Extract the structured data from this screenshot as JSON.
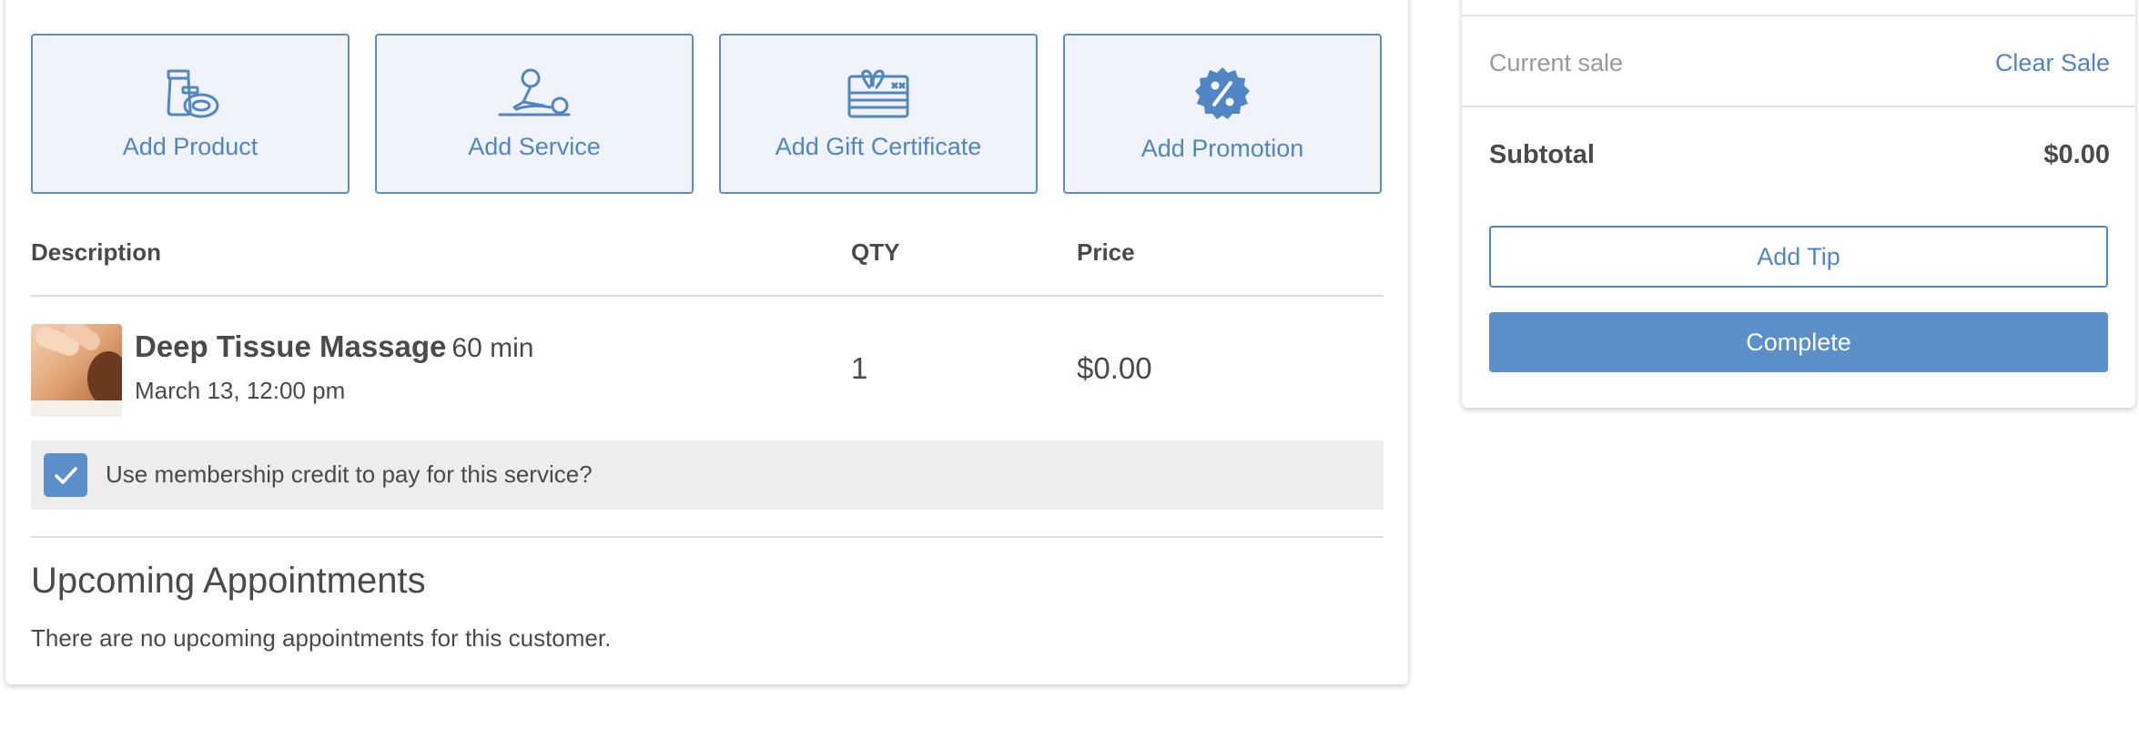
{
  "colors": {
    "accent": "#4f86c3",
    "tile_bg": "#f0f4fa",
    "primary_button": "#5b8fc9",
    "membership_bg": "#ededed",
    "text": "#4a4a4a",
    "muted_text": "#9a9a9a"
  },
  "tiles": [
    {
      "label": "Add Product",
      "icon": "product-icon"
    },
    {
      "label": "Add Service",
      "icon": "service-massage-icon"
    },
    {
      "label": "Add Gift Certificate",
      "icon": "gift-card-icon"
    },
    {
      "label": "Add Promotion",
      "icon": "promotion-percent-badge-icon"
    }
  ],
  "table": {
    "columns": {
      "description": "Description",
      "qty": "QTY",
      "price": "Price"
    },
    "items": [
      {
        "name": "Deep Tissue Massage",
        "duration": "60 min",
        "date": "March 13, 12:00 pm",
        "qty": "1",
        "price": "$0.00"
      }
    ]
  },
  "membership": {
    "checked": true,
    "label": "Use membership credit to pay for this service?"
  },
  "upcoming": {
    "title": "Upcoming Appointments",
    "empty_text": "There are no upcoming appointments for this customer."
  },
  "sale": {
    "current_label": "Current sale",
    "clear_label": "Clear Sale",
    "subtotal_label": "Subtotal",
    "subtotal_value": "$0.00",
    "add_tip_label": "Add Tip",
    "complete_label": "Complete"
  }
}
